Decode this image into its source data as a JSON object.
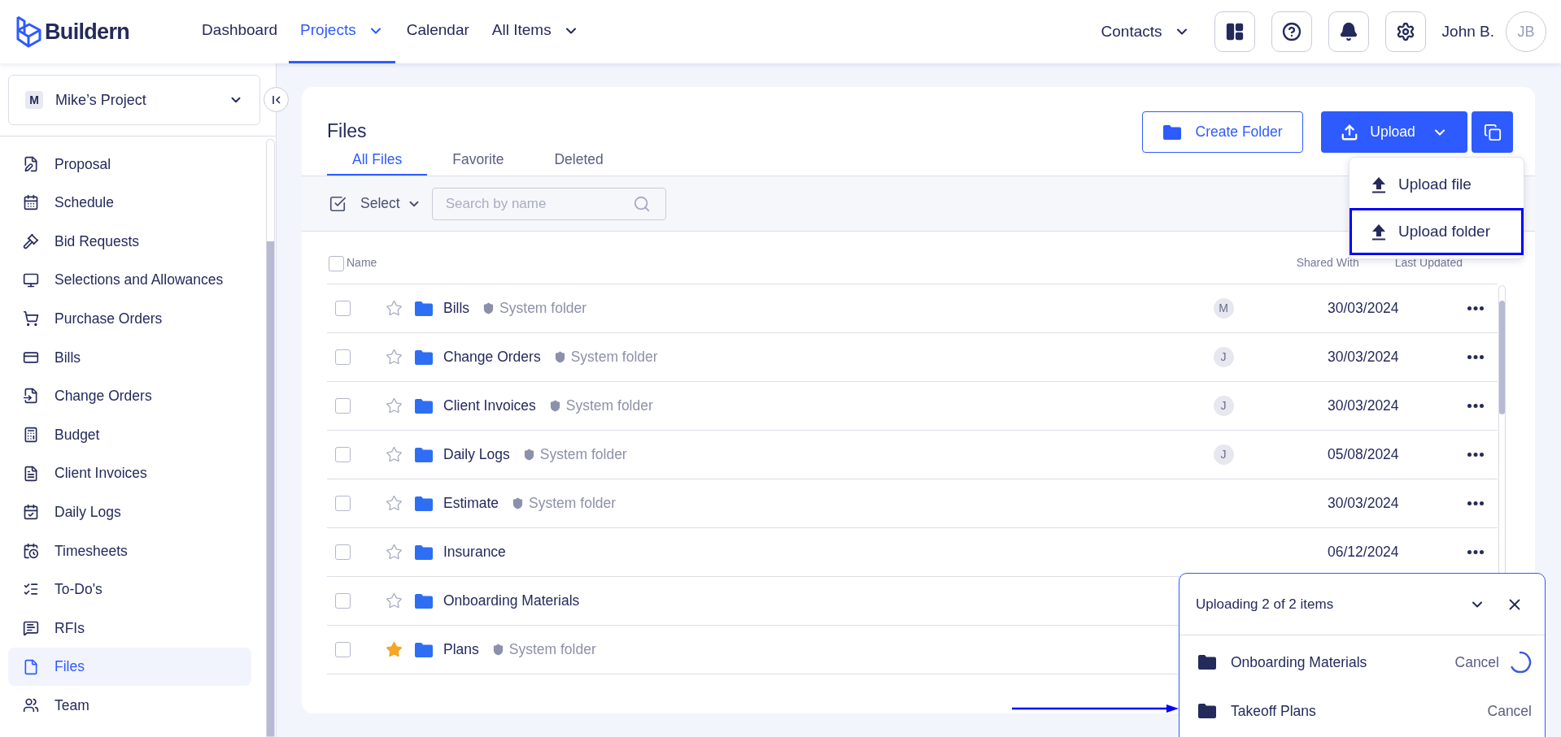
{
  "header": {
    "logo": "Buildern",
    "nav": [
      {
        "label": "Dashboard",
        "selected": false,
        "dropdown": false
      },
      {
        "label": "Projects",
        "selected": true,
        "dropdown": true
      },
      {
        "label": "Calendar",
        "selected": false,
        "dropdown": false
      },
      {
        "label": "All Items",
        "selected": false,
        "dropdown": true
      }
    ],
    "contacts": "Contacts",
    "user_name": "John B.",
    "user_initials": "JB"
  },
  "sidebar": {
    "project_badge": "M",
    "project_name": "Mike’s Project",
    "items": [
      {
        "label": "Proposal",
        "selected": false
      },
      {
        "label": "Schedule",
        "selected": false
      },
      {
        "label": "Bid Requests",
        "selected": false
      },
      {
        "label": "Selections and Allowances",
        "selected": false
      },
      {
        "label": "Purchase Orders",
        "selected": false
      },
      {
        "label": "Bills",
        "selected": false
      },
      {
        "label": "Change Orders",
        "selected": false
      },
      {
        "label": "Budget",
        "selected": false
      },
      {
        "label": "Client Invoices",
        "selected": false
      },
      {
        "label": "Daily Logs",
        "selected": false
      },
      {
        "label": "Timesheets",
        "selected": false
      },
      {
        "label": "To-Do's",
        "selected": false
      },
      {
        "label": "RFIs",
        "selected": false
      },
      {
        "label": "Files",
        "selected": true
      },
      {
        "label": "Team",
        "selected": false
      }
    ]
  },
  "files": {
    "title": "Files",
    "tabs": [
      {
        "label": "All Files",
        "selected": true
      },
      {
        "label": "Favorite",
        "selected": false
      },
      {
        "label": "Deleted",
        "selected": false
      }
    ],
    "create_folder": "Create Folder",
    "upload": "Upload",
    "upload_menu": [
      {
        "label": "Upload file",
        "highlighted": false
      },
      {
        "label": "Upload folder",
        "highlighted": true
      }
    ],
    "select": "Select",
    "search": {
      "placeholder": "Search by name"
    },
    "select_all": {
      "checked": false
    },
    "columns": {
      "name": "Name",
      "shared_with": "Shared With",
      "last_updated": "Last Updated"
    },
    "rows": [
      {
        "name": "Bills",
        "checked": false,
        "starred": false,
        "system_tag": "System folder",
        "shared": "M",
        "date": "30/03/2024"
      },
      {
        "name": "Change Orders",
        "checked": false,
        "starred": false,
        "system_tag": "System folder",
        "shared": "J",
        "date": "30/03/2024"
      },
      {
        "name": "Client Invoices",
        "checked": false,
        "starred": false,
        "system_tag": "System folder",
        "shared": "J",
        "date": "30/03/2024"
      },
      {
        "name": "Daily Logs",
        "checked": false,
        "starred": false,
        "system_tag": "System folder",
        "shared": "J",
        "date": "05/08/2024"
      },
      {
        "name": "Estimate",
        "checked": false,
        "starred": false,
        "system_tag": "System folder",
        "date": "30/03/2024"
      },
      {
        "name": "Insurance",
        "checked": false,
        "starred": false,
        "date": "06/12/2024"
      },
      {
        "name": "Onboarding Materials",
        "checked": false,
        "starred": false
      },
      {
        "name": "Plans",
        "checked": false,
        "starred": true,
        "system_tag": "System folder"
      }
    ]
  },
  "upload_panel": {
    "title": "Uploading 2 of 2 items",
    "items": [
      {
        "name": "Onboarding Materials",
        "action": "Cancel",
        "uploading": true
      },
      {
        "name": "Takeoff Plans",
        "action": "Cancel",
        "uploading": false
      }
    ]
  }
}
